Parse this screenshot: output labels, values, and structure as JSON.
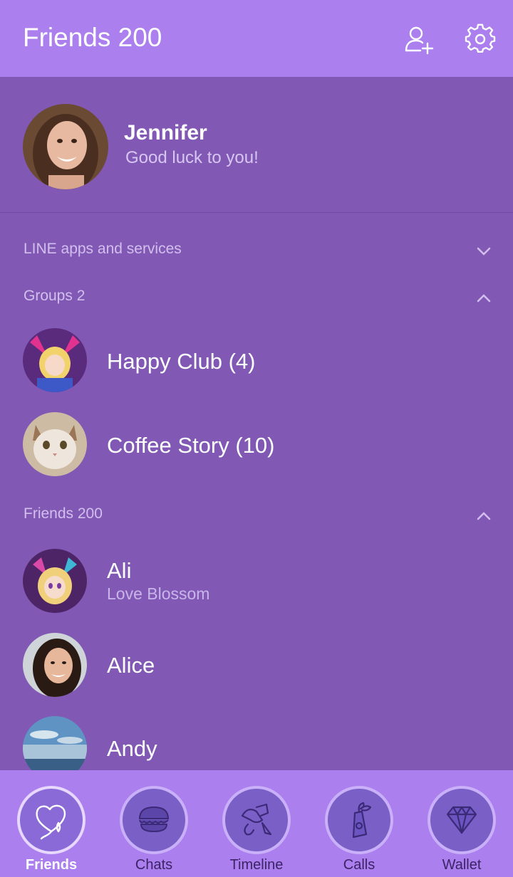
{
  "header": {
    "title": "Friends 200",
    "add_friend_icon": "add-friend-icon",
    "settings_icon": "gear-icon"
  },
  "profile": {
    "name": "Jennifer",
    "status": "Good luck to you!"
  },
  "sections": {
    "services": {
      "label": "LINE apps and services",
      "state": "collapsed"
    },
    "groups": {
      "label": "Groups 2",
      "state": "expanded"
    },
    "friends": {
      "label": "Friends 200",
      "state": "expanded"
    }
  },
  "groups": [
    {
      "name": "Happy Club (4)"
    },
    {
      "name": "Coffee Story (10)"
    }
  ],
  "friends": [
    {
      "name": "Ali",
      "status": "Love Blossom"
    },
    {
      "name": "Alice",
      "status": ""
    },
    {
      "name": "Andy",
      "status": ""
    }
  ],
  "tabs": [
    {
      "label": "Friends",
      "icon": "heart-balloon-icon",
      "active": true
    },
    {
      "label": "Chats",
      "icon": "macaron-icon",
      "active": false
    },
    {
      "label": "Timeline",
      "icon": "timeline-icon",
      "active": false
    },
    {
      "label": "Calls",
      "icon": "bottle-plant-icon",
      "active": false
    },
    {
      "label": "Wallet",
      "icon": "diamond-icon",
      "active": false
    }
  ],
  "colors": {
    "header_bg": "#ac7fee",
    "list_bg": "#8159b5",
    "tab_icon_bg": "#7a5fc7"
  }
}
